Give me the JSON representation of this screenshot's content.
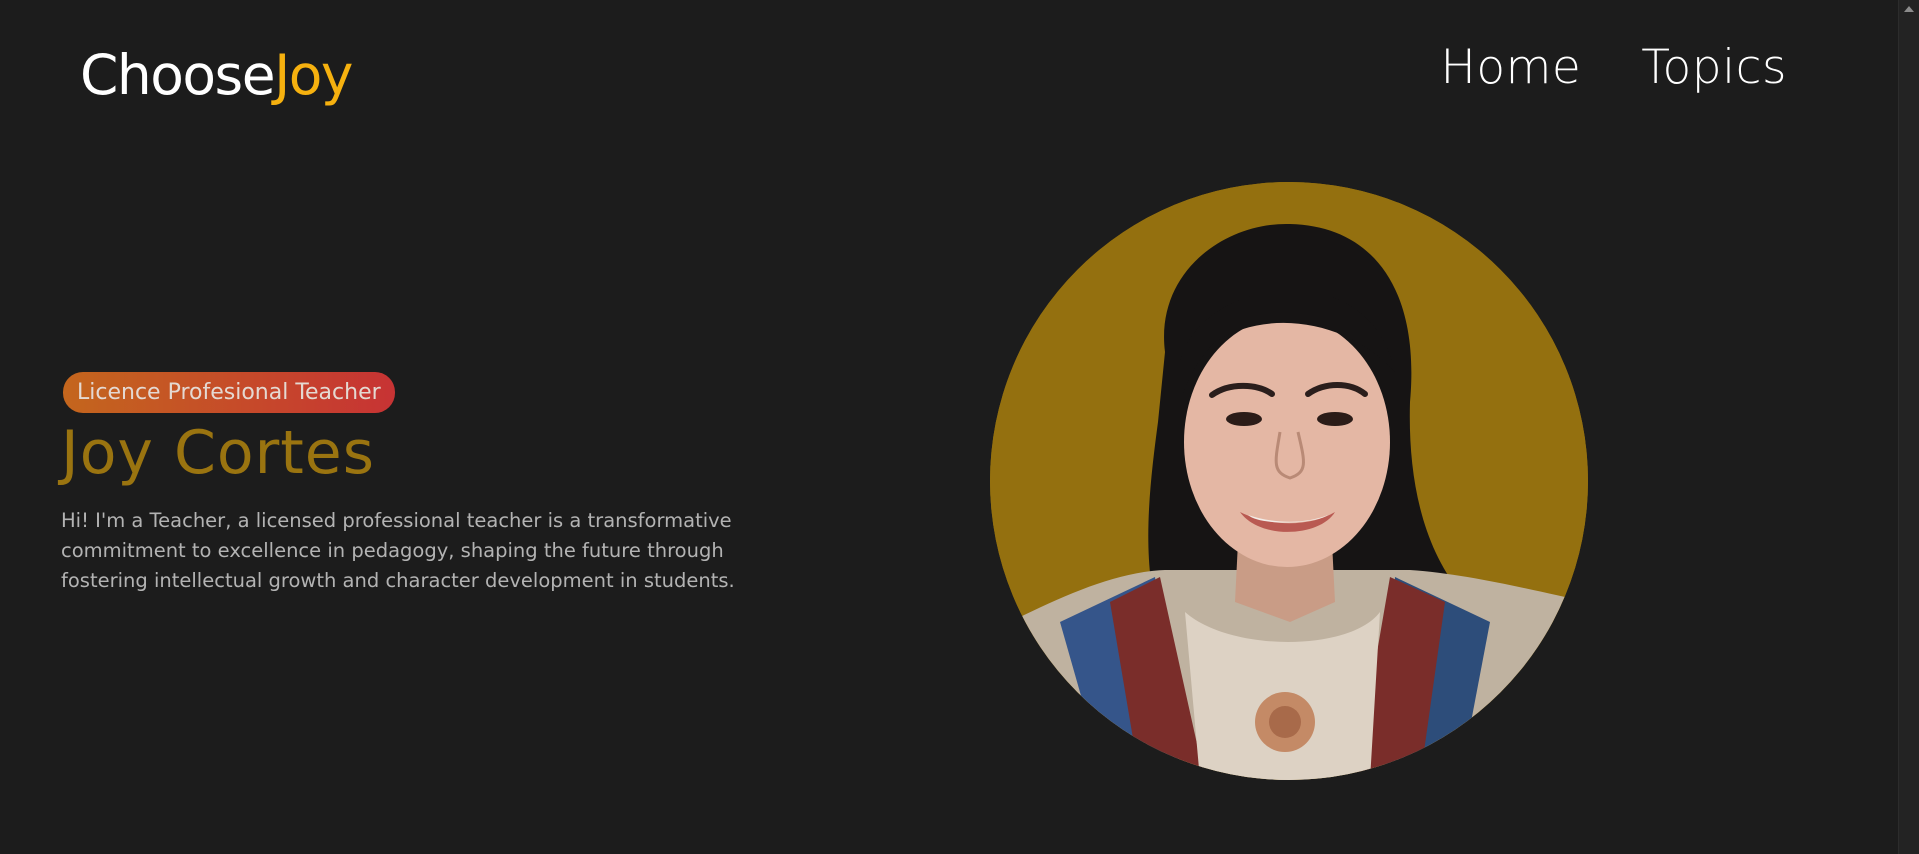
{
  "header": {
    "logo_main": "Choose",
    "logo_accent": "Joy",
    "nav": [
      {
        "label": "Home"
      },
      {
        "label": "Topics"
      }
    ]
  },
  "hero": {
    "badge": "Licence Profesional Teacher",
    "name": "Joy Cortes",
    "description": "Hi! I'm a Teacher, a licensed professional teacher is a transformative commitment to excellence in pedagogy, shaping the future through fostering intellectual growth and character development in students."
  },
  "colors": {
    "background": "#1c1c1c",
    "logo_accent": "#f6b10f",
    "name": "#9a7410",
    "badge_gradient_start": "#c4661d",
    "badge_gradient_end": "#c73334",
    "portrait_background": "#94700f"
  }
}
